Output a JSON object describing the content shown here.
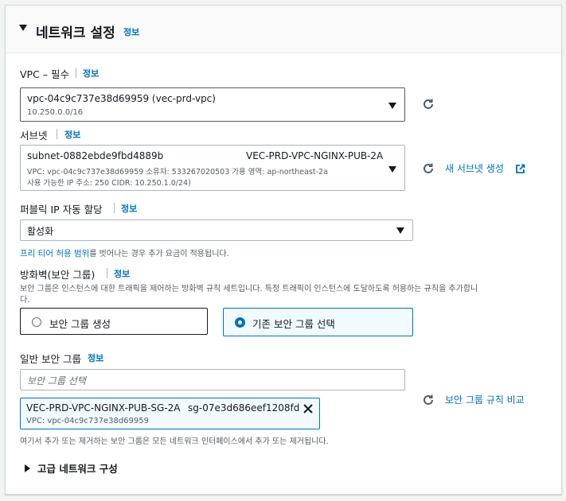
{
  "section": {
    "title": "네트워크 설정",
    "info": "정보"
  },
  "vpc": {
    "label": "VPC – 필수",
    "info": "정보",
    "selected_name": "vpc-04c9c737e38d69959 (vec-prd-vpc)",
    "selected_cidr": "10.250.0.0/16"
  },
  "subnet": {
    "label": "서브넷",
    "info": "정보",
    "selected_id": "subnet-0882ebde9fbd4889b",
    "selected_name": "VEC-PRD-VPC-NGINX-PUB-2A",
    "detail_line1": "VPC: vpc-04c9c737e38d69959     소유자: 533267020503     가용 영역: ap-northeast-2a",
    "detail_line2": "사용 가능한 IP 주소: 250     CIDR: 10.250.1.0/24)",
    "create_link": "새 서브넷 생성"
  },
  "public_ip": {
    "label": "퍼블릭 IP 자동 할당",
    "info": "정보",
    "selected": "활성화",
    "hint_link": "프리 티어 허용 범위",
    "hint_text": "를 벗어나는 경우 추가 요금이 적용됩니다."
  },
  "firewall": {
    "label": "방화벽(보안 그룹)",
    "info": "정보",
    "description_line1": "보안 그룹은 인스턴스에 대한 트래픽을 제어하는 방화벽 규칙 세트입니다. 특정 트래픽이 인스턴스에 도달하도록 허용하는 규칙을 추가합니",
    "description_line2": "다.",
    "options": [
      {
        "label": "보안 그룹 생성",
        "selected": false
      },
      {
        "label": "기존 보안 그룹 선택",
        "selected": true
      }
    ]
  },
  "common_sg": {
    "label": "일반 보안 그룹",
    "info": "정보",
    "placeholder": "보안 그룹 선택",
    "token_name": "VEC-PRD-VPC-NGINX-PUB-SG-2A",
    "token_id": "sg-07e3d686eef1208fd",
    "token_vpc": "VPC: vpc-04c9c737e38d69959",
    "compare_link": "보안 그룹 규칙 비교",
    "hint": "여기서 추가 또는 제거하는 보안 그룹은 모든 네트워크 인터페이스에서 추가 또는 제거됩니다."
  },
  "advanced": {
    "label": "고급 네트워크 구성"
  },
  "colors": {
    "link": "#0073bb",
    "text": "#16191f",
    "secondary_text": "#545b64",
    "border": "#aab7b8",
    "selected_bg": "#f1faff"
  }
}
